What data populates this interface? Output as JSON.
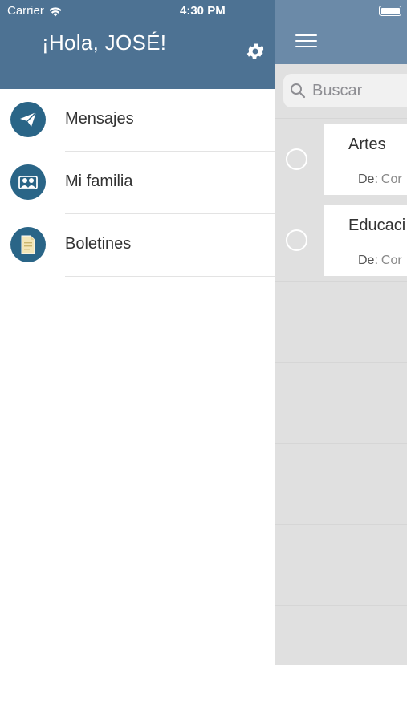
{
  "status_bar": {
    "carrier": "Carrier",
    "time": "4:30 PM"
  },
  "drawer": {
    "greeting": "¡Hola, JOSÉ!",
    "header_color": "#4d7293",
    "menu": [
      {
        "label": "Mensajes",
        "icon": "paper-plane-icon"
      },
      {
        "label": "Mi familia",
        "icon": "family-icon"
      },
      {
        "label": "Boletines",
        "icon": "document-icon"
      }
    ]
  },
  "main": {
    "header_color": "#6b8aa8",
    "search": {
      "placeholder": "Buscar"
    },
    "messages": [
      {
        "subject": "Artes",
        "from_label": "De:",
        "from_value": "Cor"
      },
      {
        "subject": "Educaci",
        "from_label": "De:",
        "from_value": "Cor"
      }
    ]
  }
}
